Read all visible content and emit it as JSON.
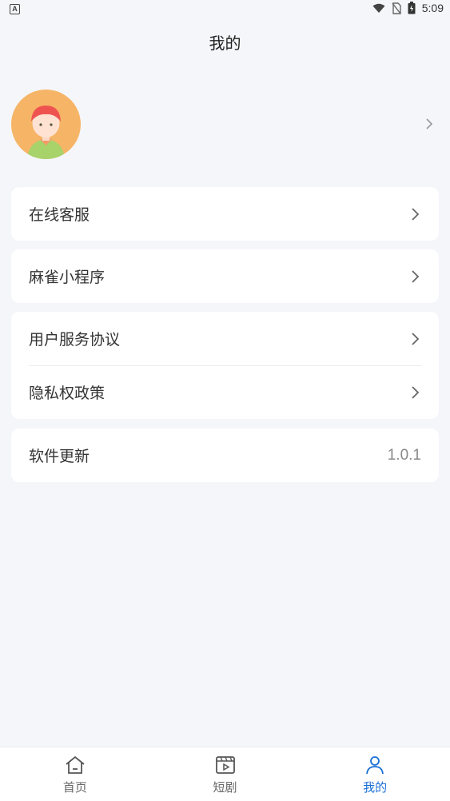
{
  "status_bar": {
    "left_glyph": "A",
    "time": "5:09",
    "icons": [
      "wifi-icon",
      "no-sim-icon",
      "battery-icon"
    ]
  },
  "header": {
    "title": "我的"
  },
  "profile": {
    "avatar": "avatar-icon",
    "name": ""
  },
  "menu": {
    "customer_service": "在线客服",
    "mini_program": "麻雀小程序",
    "user_agreement": "用户服务协议",
    "privacy_policy": "隐私权政策",
    "software_update": "软件更新",
    "version": "1.0.1"
  },
  "tabs": [
    {
      "label": "首页",
      "icon": "home-icon"
    },
    {
      "label": "短剧",
      "icon": "video-icon"
    },
    {
      "label": "我的",
      "icon": "user-icon",
      "active": true
    }
  ],
  "colors": {
    "accent": "#1a6fd6",
    "background": "#f5f6fa",
    "avatar_bg": "#f6b466"
  }
}
